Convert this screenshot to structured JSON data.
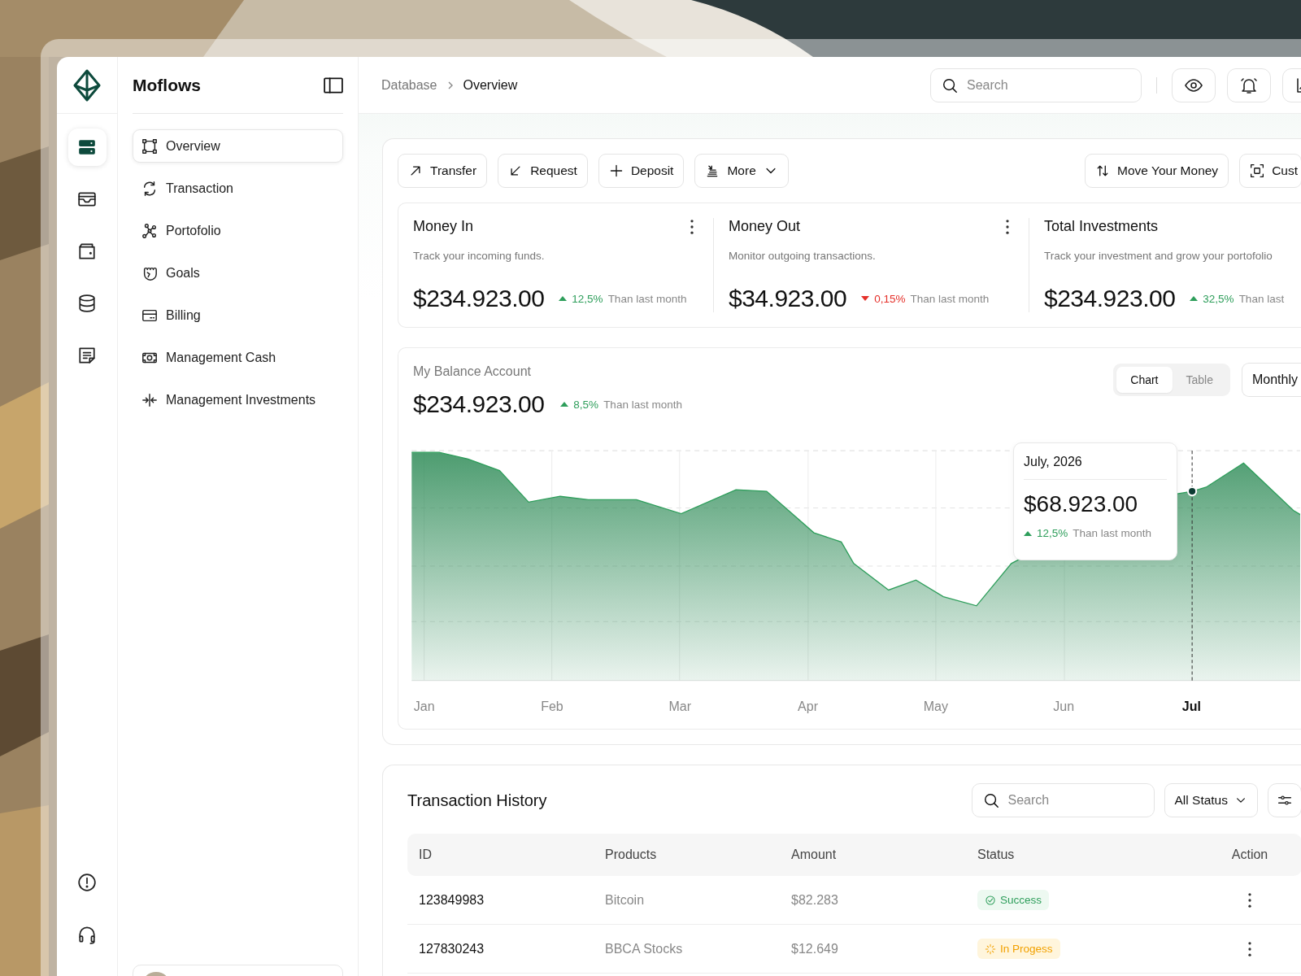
{
  "brand": {
    "name": "Moflows"
  },
  "rail": [
    {
      "kind": "server",
      "selected": true
    },
    {
      "kind": "inbox",
      "selected": false
    },
    {
      "kind": "wallet",
      "selected": false
    },
    {
      "kind": "database",
      "selected": false
    },
    {
      "kind": "note",
      "selected": false
    }
  ],
  "rail_bottom": [
    {
      "kind": "alert"
    },
    {
      "kind": "headset"
    }
  ],
  "nav": [
    {
      "label": "Overview",
      "kind": "overview",
      "selected": true
    },
    {
      "label": "Transaction",
      "kind": "transaction",
      "selected": false
    },
    {
      "label": "Portofolio",
      "kind": "portfolio",
      "selected": false
    },
    {
      "label": "Goals",
      "kind": "goals",
      "selected": false
    },
    {
      "label": "Billing",
      "kind": "billing",
      "selected": false
    },
    {
      "label": "Management Cash",
      "kind": "cash",
      "selected": false
    },
    {
      "label": "Management Investments",
      "kind": "invest",
      "selected": false
    }
  ],
  "breadcrumb": [
    "Database",
    "Overview"
  ],
  "search": {
    "placeholder": "Search"
  },
  "header_buttons": [
    {
      "kind": "eye"
    },
    {
      "kind": "bell"
    },
    {
      "kind": "chart"
    }
  ],
  "actions": [
    {
      "label": "Transfer",
      "kind": "transfer"
    },
    {
      "label": "Request",
      "kind": "request"
    },
    {
      "label": "Deposit",
      "kind": "deposit"
    },
    {
      "label": "More",
      "kind": "more"
    }
  ],
  "actions_right": [
    {
      "label": "Move Your Money",
      "kind": "move"
    },
    {
      "label": "Cust",
      "kind": "custom"
    }
  ],
  "stats": [
    {
      "title": "Money In",
      "subtitle": "Track your incoming funds.",
      "value": "$234.923.00",
      "change": "12,5%",
      "rising": true,
      "note": "Than last month",
      "menu": true
    },
    {
      "title": "Money Out",
      "subtitle": "Monitor outgoing transactions.",
      "value": "$34.923.00",
      "change": "0,15%",
      "rising": false,
      "note": "Than last month",
      "menu": true
    },
    {
      "title": "Total Investments",
      "subtitle": "Track your investment and grow your portofolio",
      "value": "$234.923.00",
      "change": "32,5%",
      "rising": true,
      "note": "Than last",
      "menu": false
    }
  ],
  "balance": {
    "title": "My Balance Account",
    "value": "$234.923.00",
    "change": "8,5%",
    "rising": true,
    "note": "Than last month",
    "views": [
      {
        "label": "Chart",
        "selected": true
      },
      {
        "label": "Table",
        "selected": false
      }
    ],
    "period": "Monthly",
    "months": [
      {
        "label": "Jan",
        "selected": false
      },
      {
        "label": "Feb",
        "selected": false
      },
      {
        "label": "Mar",
        "selected": false
      },
      {
        "label": "Apr",
        "selected": false
      },
      {
        "label": "May",
        "selected": false
      },
      {
        "label": "Jun",
        "selected": false
      },
      {
        "label": "Jul",
        "selected": true
      }
    ],
    "tooltip": {
      "title": "July, 2026",
      "value": "$68.923.00",
      "change": "12,5%",
      "rising": true,
      "note": "Than last month"
    }
  },
  "transactions": {
    "title": "Transaction History",
    "search": {
      "placeholder": "Search"
    },
    "filter": "All Status",
    "columns": [
      "ID",
      "Products",
      "Amount",
      "Status",
      "Action"
    ],
    "rows": [
      {
        "id": "123849983",
        "product": "Bitcoin",
        "amount": "$82.283",
        "status": {
          "label": "Success",
          "kind": "success"
        }
      },
      {
        "id": "127830243",
        "product": "BBCA Stocks",
        "amount": "$12.649",
        "status": {
          "label": "In Progess",
          "kind": "progress"
        }
      }
    ]
  }
}
